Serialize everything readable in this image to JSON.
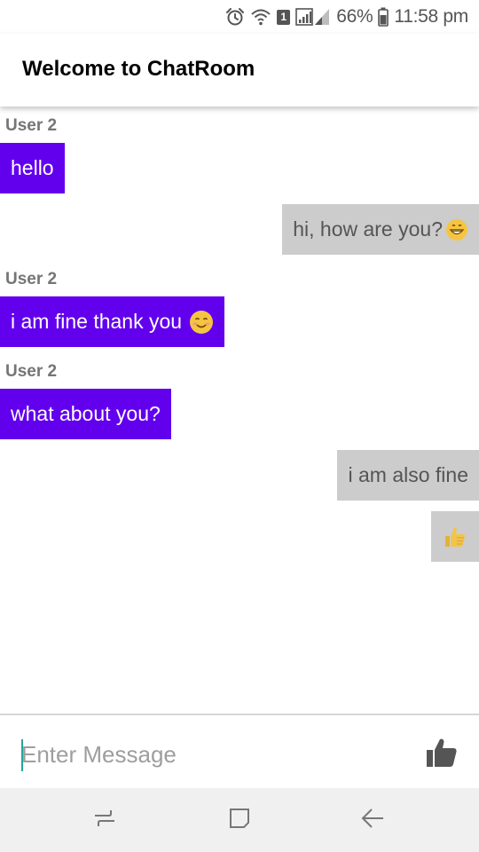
{
  "status_bar": {
    "sim_slot": "1",
    "battery_percent": "66%",
    "time": "11:58 pm",
    "icons": [
      "alarm-icon",
      "wifi-icon",
      "sim-icon",
      "signal-icon",
      "battery-icon"
    ]
  },
  "app_bar": {
    "title": "Welcome to ChatRoom"
  },
  "messages": [
    {
      "direction": "incoming",
      "sender": "User 2",
      "text": "hello"
    },
    {
      "direction": "outgoing",
      "text": "hi, how are you?",
      "emoji": "grinning-face-emoji"
    },
    {
      "direction": "incoming",
      "sender": "User 2",
      "text": "i am fine thank you",
      "emoji": "smiling-face-emoji"
    },
    {
      "direction": "incoming",
      "sender": "User 2",
      "text": "what about you?"
    },
    {
      "direction": "outgoing",
      "text": "i am also fine"
    },
    {
      "direction": "outgoing",
      "text": "",
      "emoji": "thumbs-up-emoji"
    }
  ],
  "composer": {
    "placeholder": "Enter Message",
    "value": "",
    "send_icon": "thumbs-up-icon"
  },
  "nav_bar": {
    "buttons": [
      "recents-icon",
      "home-icon",
      "back-icon"
    ]
  },
  "colors": {
    "incoming_bubble": "#6200ee",
    "outgoing_bubble": "#cccccc",
    "sender_label": "#757575",
    "cursor": "#26a69a"
  }
}
